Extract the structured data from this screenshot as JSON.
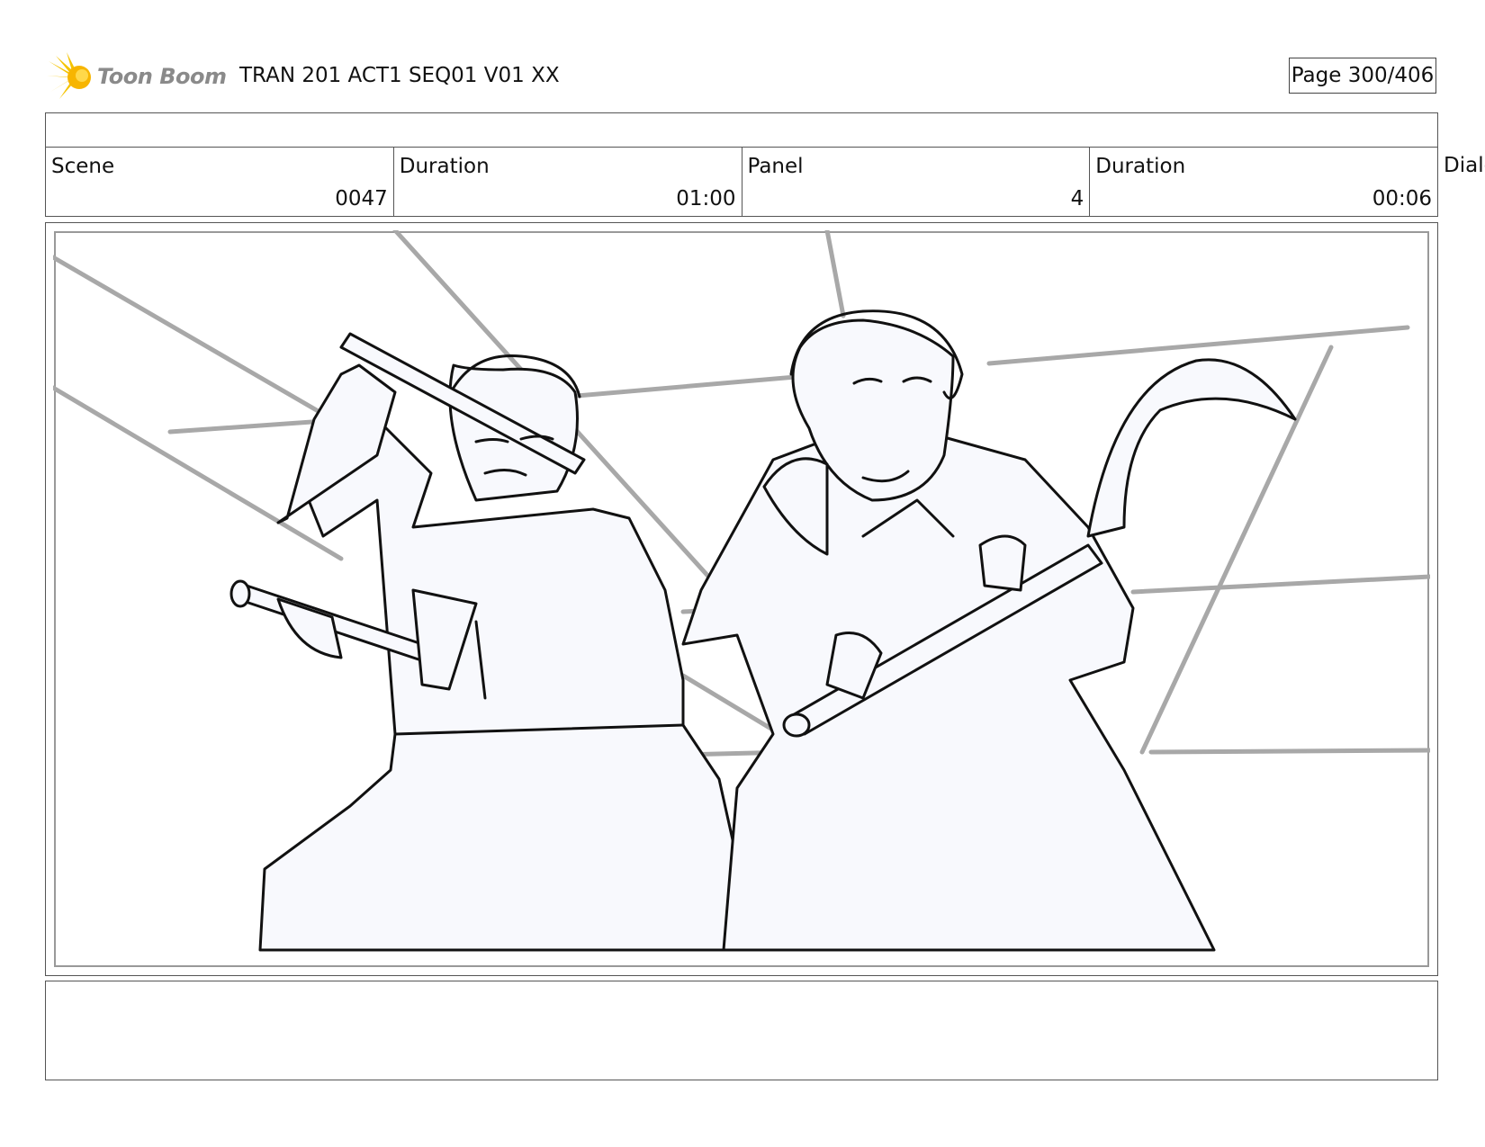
{
  "header": {
    "logo_text": "Toon Boom",
    "title": "TRAN 201 ACT1 SEQ01 V01 XX",
    "page_label": "Page 300/406"
  },
  "info": {
    "scene_label": "Scene",
    "scene_value": "0047",
    "scene_duration_label": "Duration",
    "scene_duration_value": "01:00",
    "panel_label": "Panel",
    "panel_value": "4",
    "panel_duration_label": "Duration",
    "panel_duration_value": "00:06",
    "dialog_label_partial": "Dialo"
  },
  "colors": {
    "logo_star": "#f5c400",
    "border": "#555555",
    "speed_lines": "#a8a8a8"
  },
  "icons": {
    "logo": "starburst-logo-icon"
  }
}
